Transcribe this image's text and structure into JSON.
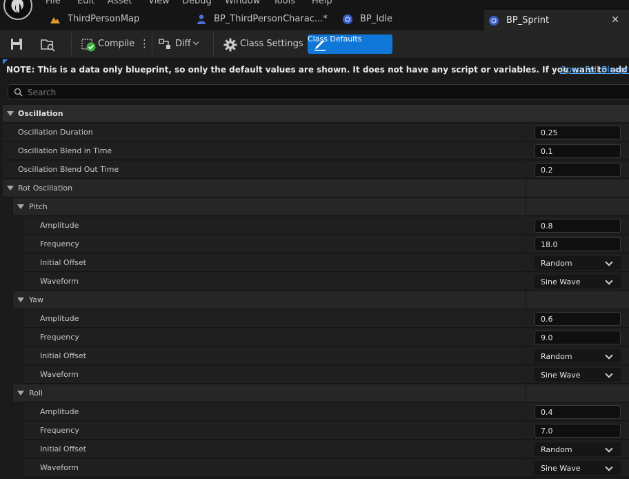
{
  "menu": [
    "File",
    "Edit",
    "Asset",
    "View",
    "Debug",
    "Window",
    "Tools",
    "Help"
  ],
  "tabs": [
    {
      "label": "ThirdPersonMap",
      "icon": "level-icon"
    },
    {
      "label": "BP_ThirdPersonCharac...*",
      "icon": "character-icon"
    },
    {
      "label": "BP_Idle",
      "icon": "blueprint-icon"
    },
    {
      "label": "BP_Sprint",
      "icon": "blueprint-icon",
      "active": true
    }
  ],
  "toolbar": {
    "compile": "Compile",
    "diff": "Diff",
    "class_settings": "Class Settings",
    "class_defaults": "Class Defaults"
  },
  "note": {
    "text": "NOTE: This is a data only blueprint, so only the default values are shown.  It does not have any script or variables.  If you want to add some, ",
    "link": "Open Full Blueprint Editor"
  },
  "search": {
    "placeholder": "Search"
  },
  "details": {
    "oscillation_header": "Oscillation",
    "duration_label": "Oscillation Duration",
    "duration_value": "0.25",
    "blend_in_label": "Oscillation Blend in Time",
    "blend_in_value": "0.1",
    "blend_out_label": "Oscillation Blend Out Time",
    "blend_out_value": "0.2",
    "rot_header": "Rot Oscillation",
    "pitch": {
      "label": "Pitch",
      "amplitude": "0.8",
      "frequency": "18.0",
      "offset": "Random",
      "waveform": "Sine Wave"
    },
    "yaw": {
      "label": "Yaw",
      "amplitude": "0.6",
      "frequency": "9.0",
      "offset": "Random",
      "waveform": "Sine Wave"
    },
    "roll": {
      "label": "Roll",
      "amplitude": "0.4",
      "frequency": "7.0",
      "offset": "Random",
      "waveform": "Sine Wave"
    },
    "amplitude_label": "Amplitude",
    "frequency_label": "Frequency",
    "offset_label": "Initial Offset",
    "waveform_label": "Waveform"
  },
  "colors": {
    "accent": "#0f77d8",
    "link": "#4ea6ff",
    "panel": "#1f1f1f"
  }
}
